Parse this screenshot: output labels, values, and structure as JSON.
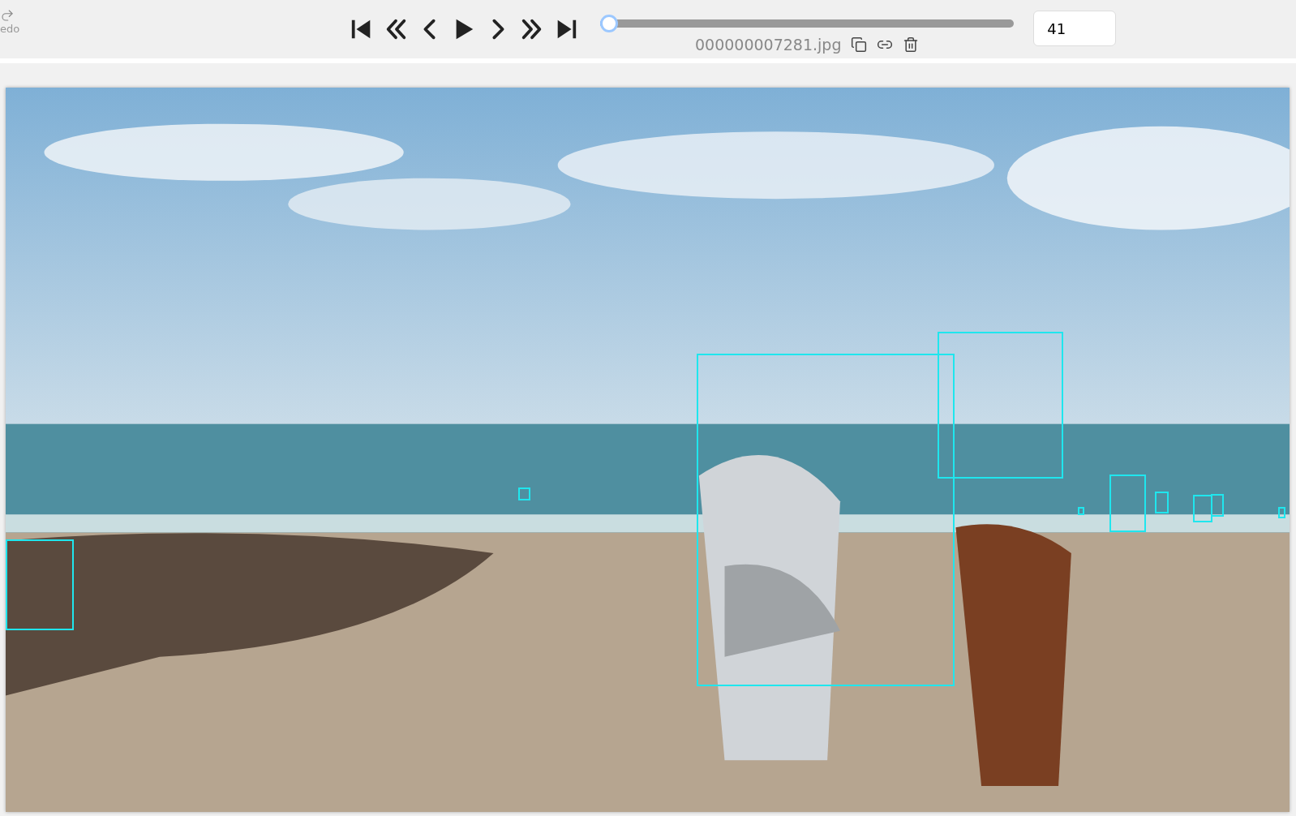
{
  "toolbar": {
    "redo": {
      "label": "edo"
    },
    "playback_buttons": [
      {
        "kind": "first"
      },
      {
        "kind": "back-fast"
      },
      {
        "kind": "back"
      },
      {
        "kind": "play"
      },
      {
        "kind": "forward"
      },
      {
        "kind": "forward-fast"
      },
      {
        "kind": "last"
      }
    ],
    "frame_slider": {
      "level": 0.02
    },
    "file_name": "000000007281.jpg",
    "file_actions": [
      {
        "kind": "copy"
      },
      {
        "kind": "link"
      },
      {
        "kind": "delete"
      }
    ],
    "frame_number": "41"
  }
}
